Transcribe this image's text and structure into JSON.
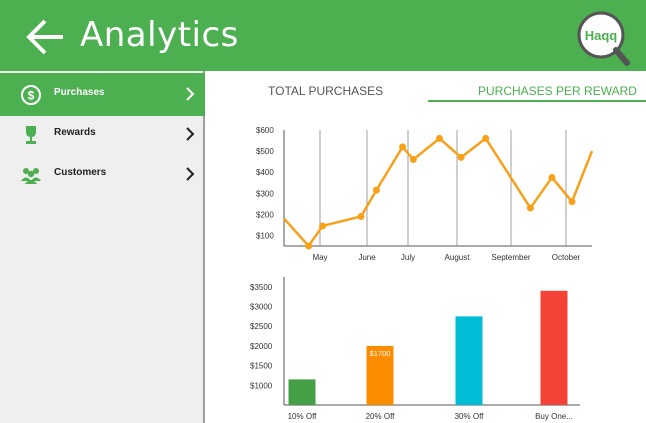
{
  "header": {
    "title": "Analytics",
    "logo_text": "Haqq"
  },
  "sidebar": {
    "items": [
      {
        "label": "Purchases",
        "icon": "dollar-circle-icon",
        "active": true
      },
      {
        "label": "Rewards",
        "icon": "trophy-icon",
        "active": false
      },
      {
        "label": "Customers",
        "icon": "people-icon",
        "active": false
      }
    ]
  },
  "tabs": [
    {
      "label": "TOTAL PURCHASES",
      "active": false
    },
    {
      "label": "PURCHASES PER REWARD",
      "active": true
    }
  ],
  "colors": {
    "green": "#4caf50",
    "line": "#f7a11a",
    "bars": [
      "#43a047",
      "#fb8c00",
      "#00bcd4",
      "#f44336"
    ]
  },
  "chart_data": [
    {
      "type": "line",
      "y_ticks": [
        "$600",
        "$500",
        "$400",
        "$300",
        "$200",
        "$100"
      ],
      "ylim": [
        50,
        600
      ],
      "x_labels": [
        "May",
        "June",
        "July",
        "August",
        "September",
        "October"
      ],
      "series": [
        {
          "values": [
            180,
            50,
            145,
            190,
            315,
            520,
            460,
            560,
            470,
            560,
            230,
            375,
            260,
            500
          ]
        }
      ],
      "x_positions": [
        0.0,
        0.08,
        0.125,
        0.25,
        0.3,
        0.385,
        0.42,
        0.505,
        0.575,
        0.655,
        0.8,
        0.87,
        0.935,
        1.0
      ]
    },
    {
      "type": "bar",
      "y_ticks": [
        "$3500",
        "$3000",
        "$2500",
        "$2000",
        "$1500",
        "$1000"
      ],
      "ylim": [
        500,
        3750
      ],
      "categories": [
        "10% Off",
        "20% Off",
        "30% Off",
        "Buy One..."
      ],
      "values": [
        1150,
        2000,
        2750,
        3400
      ],
      "data_labels": [
        "",
        "$1700",
        "",
        ""
      ]
    }
  ]
}
